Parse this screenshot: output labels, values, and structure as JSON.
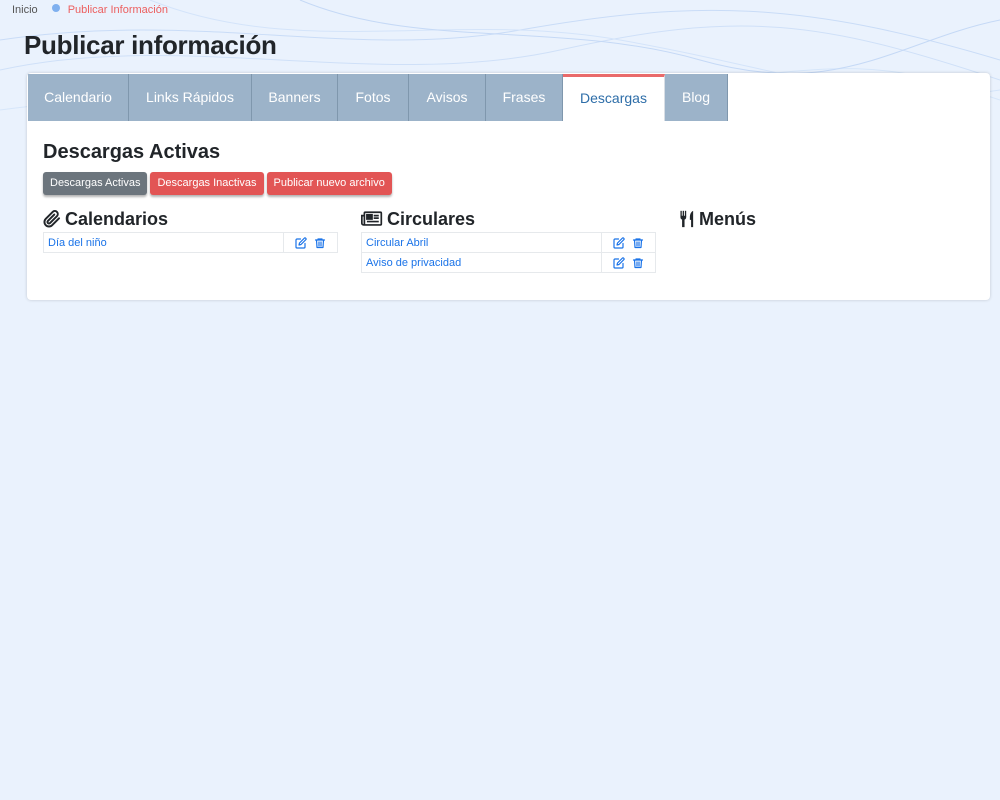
{
  "breadcrumb": {
    "home": "Inicio",
    "current": "Publicar Información"
  },
  "page": {
    "title": "Publicar información"
  },
  "tabs": [
    {
      "label": "Calendario",
      "active": false
    },
    {
      "label": "Links Rápidos",
      "active": false
    },
    {
      "label": "Banners",
      "active": false
    },
    {
      "label": "Fotos",
      "active": false
    },
    {
      "label": "Avisos",
      "active": false
    },
    {
      "label": "Frases",
      "active": false
    },
    {
      "label": "Descargas",
      "active": true
    },
    {
      "label": "Blog",
      "active": false
    }
  ],
  "section": {
    "title": "Descargas Activas",
    "buttons": {
      "active": "Descargas Activas",
      "inactive": "Descargas Inactivas",
      "publish": "Publicar nuevo archivo"
    }
  },
  "columns": {
    "calendarios": {
      "title": "Calendarios",
      "icon": "paperclip-icon",
      "files": [
        {
          "name": "Día del niño"
        }
      ]
    },
    "circulares": {
      "title": "Circulares",
      "icon": "newspaper-icon",
      "files": [
        {
          "name": "Circular Abril"
        },
        {
          "name": "Aviso de privacidad"
        }
      ]
    },
    "menus": {
      "title": "Menús",
      "icon": "utensils-icon",
      "files": []
    }
  },
  "colors": {
    "accent_red": "#e25555",
    "tab_bg": "#9cb3c9",
    "link_blue": "#1a73e8",
    "active_tab_text": "#2d6da8"
  }
}
